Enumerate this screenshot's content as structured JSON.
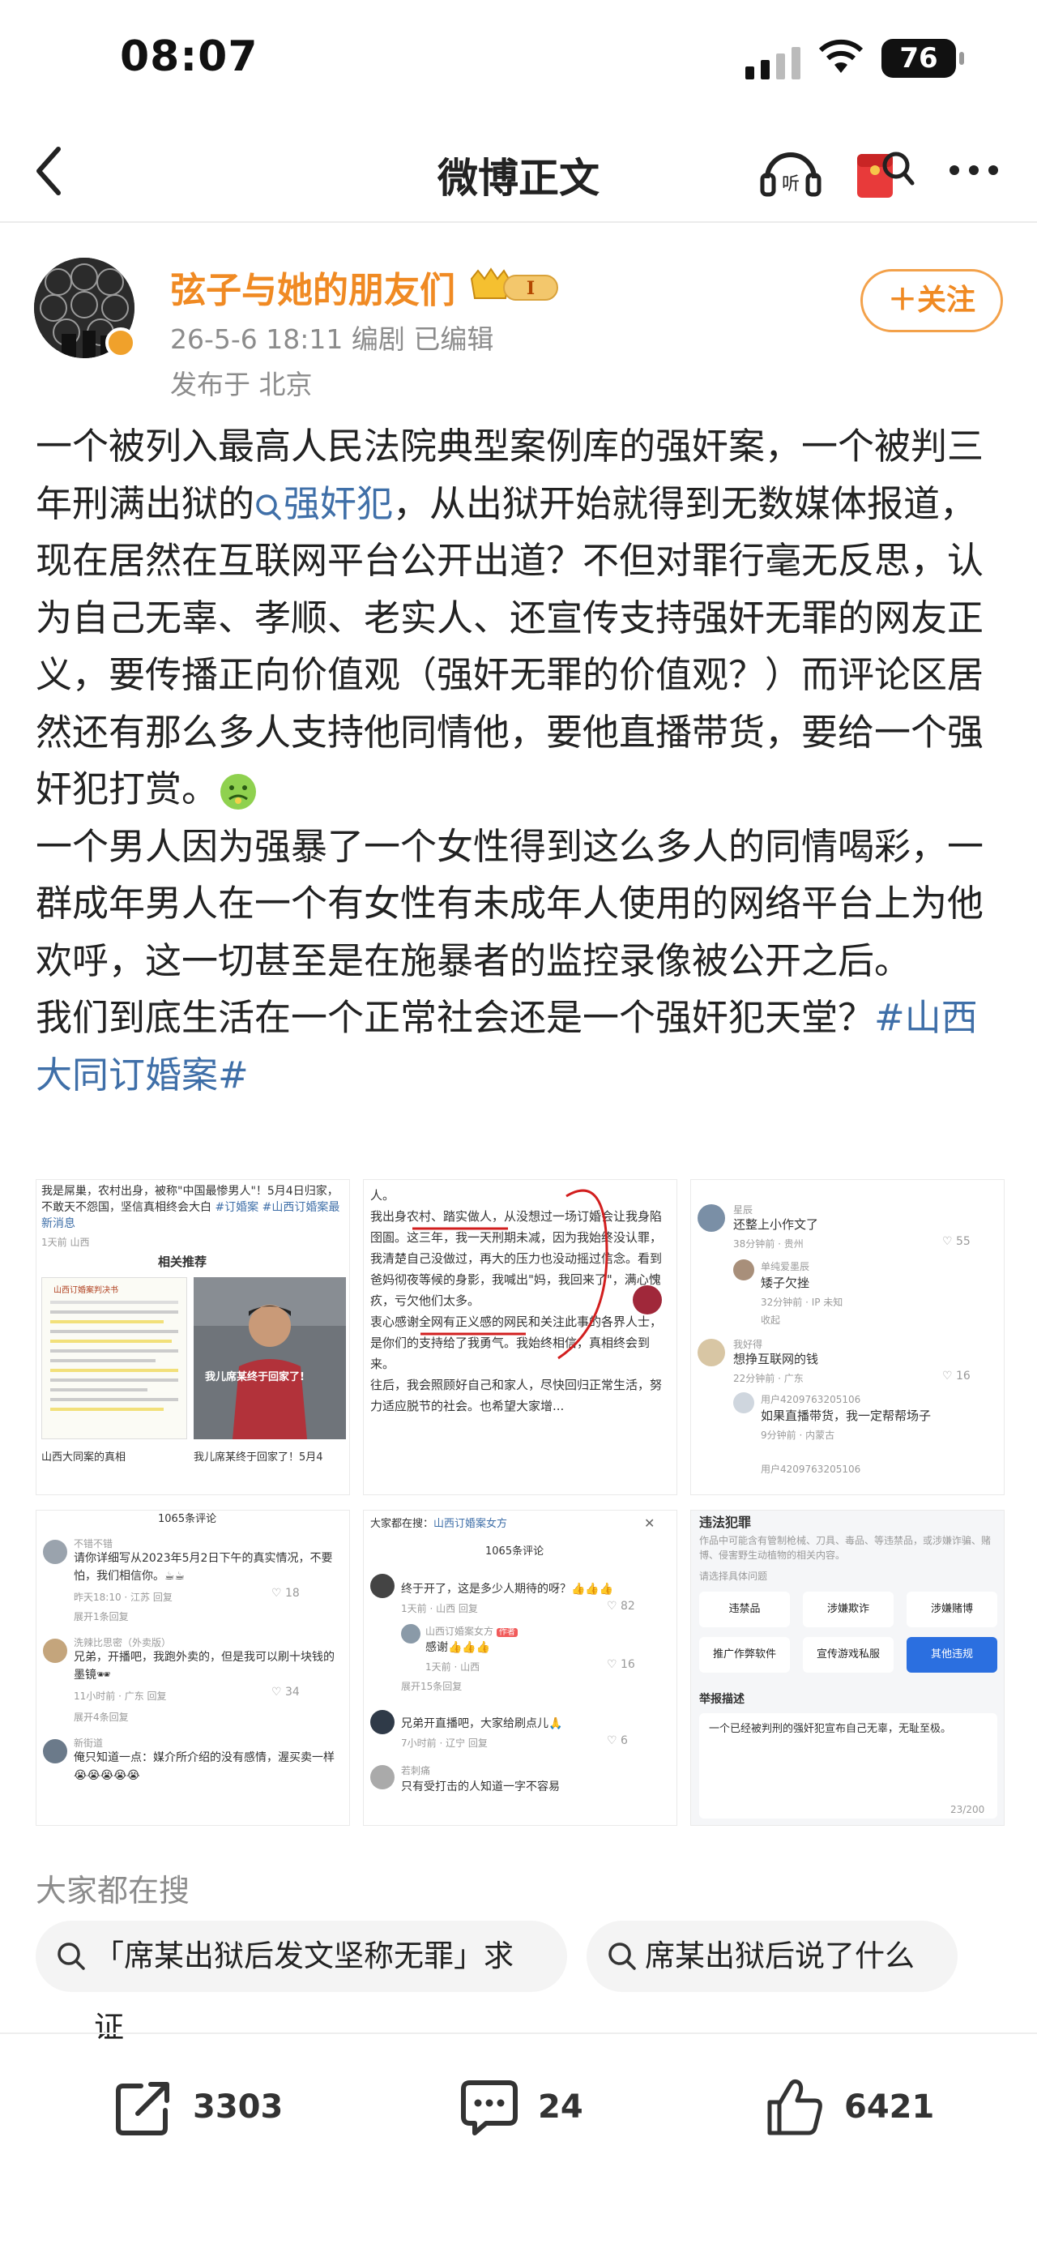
{
  "status_bar": {
    "time": "08:07",
    "battery": "76"
  },
  "nav": {
    "title": "微博正文"
  },
  "author": {
    "name": "弦子与她的朋友们",
    "vip_level": "I",
    "meta": "26-5-6 18:11  编剧  已编辑",
    "location": "发布于 北京",
    "follow_label": "＋关注"
  },
  "post": {
    "p1_a": "一个被列入最高人民法院典型案例库的强奸案，一个被判三年刑满出狱的",
    "p1_link": "强奸犯",
    "p1_b": "，从出狱开始就得到无数媒体报道，现在居然在互联网平台公开出道？不但对罪行毫无反思，认为自己无辜、孝顺、老实人、还宣传支持强奸无罪的网友正义，要传播正向价值观（强奸无罪的价值观？）而评论区居然还有那么多人支持他同情他，要他直播带货，要给一个强奸犯打赏。",
    "p2": "一个男人因为强暴了一个女性得到这么多人的同情喝彩，一群成年男人在一个有女性有未成年人使用的网络平台上为他欢呼，这一切甚至是在施暴者的监控录像被公开之后。",
    "p3": "我们到底生活在一个正常社会还是一个强奸犯天堂？",
    "topic": "#山西大同订婚案#"
  },
  "grid": {
    "t1": {
      "headline": "我是屌巢，农村出身，被称\"中国最惨男人\"！5月4日归家，不敢天不怨国，坚信真相终会大白",
      "tag": "#订婚案 #山西订婚案最新消息",
      "date": "1天前 山西",
      "section": "相关推荐",
      "doc_title": "山西订婚案判决书",
      "subtitle": "我儿席某终于回家了!",
      "cap_left": "山西大同案的真相",
      "cap_right": "我儿席某终于回家了！5月4"
    },
    "t2": {
      "lines": [
        "人。",
        "我出身农村、踏实做人，从没想过一场订婚会让我身陷囹圄。这三年，我一天刑期未减，因为我始终没认罪，我清楚自己没做过，再大的压力也没动摇过信念。看到爸妈彻夜等候的身影，我喊出\"妈，我回来了\"，满心愧疚，亏欠他们太多。",
        "衷心感谢全网有正义感的网民和关注此事的各界人士，是你们的支持给了我勇气。我始终相信，真相终会到来。",
        "往后，我会照顾好自己和家人，尽快回归正常生活，努力适应脱节的社会。也希望大家增..."
      ]
    },
    "t3": {
      "c1_user": "星辰",
      "c1_text": "还整上小作文了",
      "c1_meta": "38分钟前 · 贵州",
      "c1_likes": "55",
      "c2_user": "单纯爱墨辰",
      "c2_text": "矮子欠挫",
      "c2_meta": "32分钟前 · IP 未知",
      "collapse": "收起",
      "c3_user": "我好得",
      "c3_text": "想挣互联网的钱",
      "c3_meta": "22分钟前 · 广东",
      "c3_likes": "16",
      "c4_user": "用户4209763205106",
      "c4_text": "如果直播带货，我一定帮帮场子",
      "c4_meta": "9分钟前 · 内蒙古",
      "c5_user": "用户4209763205106"
    },
    "t4": {
      "count": "1065条评论",
      "c1_user": "不错不错",
      "c1_text": "请你详细写从2023年5月2日下午的真实情况，不要怕，我们相信你。☕☕",
      "c1_meta": "昨天18:10 · 江苏  回复",
      "c1_likes": "18",
      "c1_more": "展开1条回复",
      "c2_user": "洗辣比思密（外卖版）",
      "c2_text": "兄弟，开播吧，我跑外卖的，但是我可以刷十块钱的墨镜🕶",
      "c2_meta": "11小时前 · 广东  回复",
      "c2_likes": "34",
      "c2_more": "展开4条回复",
      "c3_user": "新街道",
      "c3_text": "俺只知道一点：媒介所介绍的没有感情，渥买卖一样😭😭😭😭😭"
    },
    "t5": {
      "header": "大家都在搜：",
      "header_link": "山西订婚案女方",
      "count": "1065条评论",
      "c1_text": "终于开了，这是多少人期待的呀？👍👍👍",
      "c1_meta": "1天前 · 山西  回复",
      "c1_likes": "82",
      "c2_user": "山西订婚案女方",
      "c2_badge": "作者",
      "c2_text": "感谢👍👍👍",
      "c2_meta": "1天前 · 山西",
      "c2_likes": "16",
      "c2_more": "展开15条回复",
      "c3_text": "兄弟开直播吧，大家给刷点儿🙏",
      "c3_meta": "7小时前 · 辽宁  回复",
      "c3_likes": "6",
      "c4_user": "若刺痛",
      "c4_text": "只有受打击的人知道一字不容易"
    },
    "t6": {
      "title": "违法犯罪",
      "desc": "作品中可能含有管制枪械、刀具、毒品、等违禁品，或涉嫌诈骗、赌博、侵害野生动植物的相关内容。",
      "prompt": "请选择具体问题",
      "opts": [
        "违禁品",
        "涉嫌欺诈",
        "涉嫌赌博",
        "推广作弊软件",
        "宣传游戏私服",
        "其他违规"
      ],
      "report_title": "举报描述",
      "report_text": "一个已经被判刑的强奸犯宣布自己无辜，无耻至极。",
      "counter": "23/200"
    }
  },
  "searches": {
    "label": "大家都在搜",
    "chips": [
      "「席某出狱后发文坚称无罪」求证",
      "席某出狱后说了什么"
    ]
  },
  "actions": {
    "share_count": "3303",
    "comment_count": "24",
    "like_count": "6421"
  },
  "colors": {
    "accent": "#f08a23",
    "link": "#3f6fa8"
  }
}
